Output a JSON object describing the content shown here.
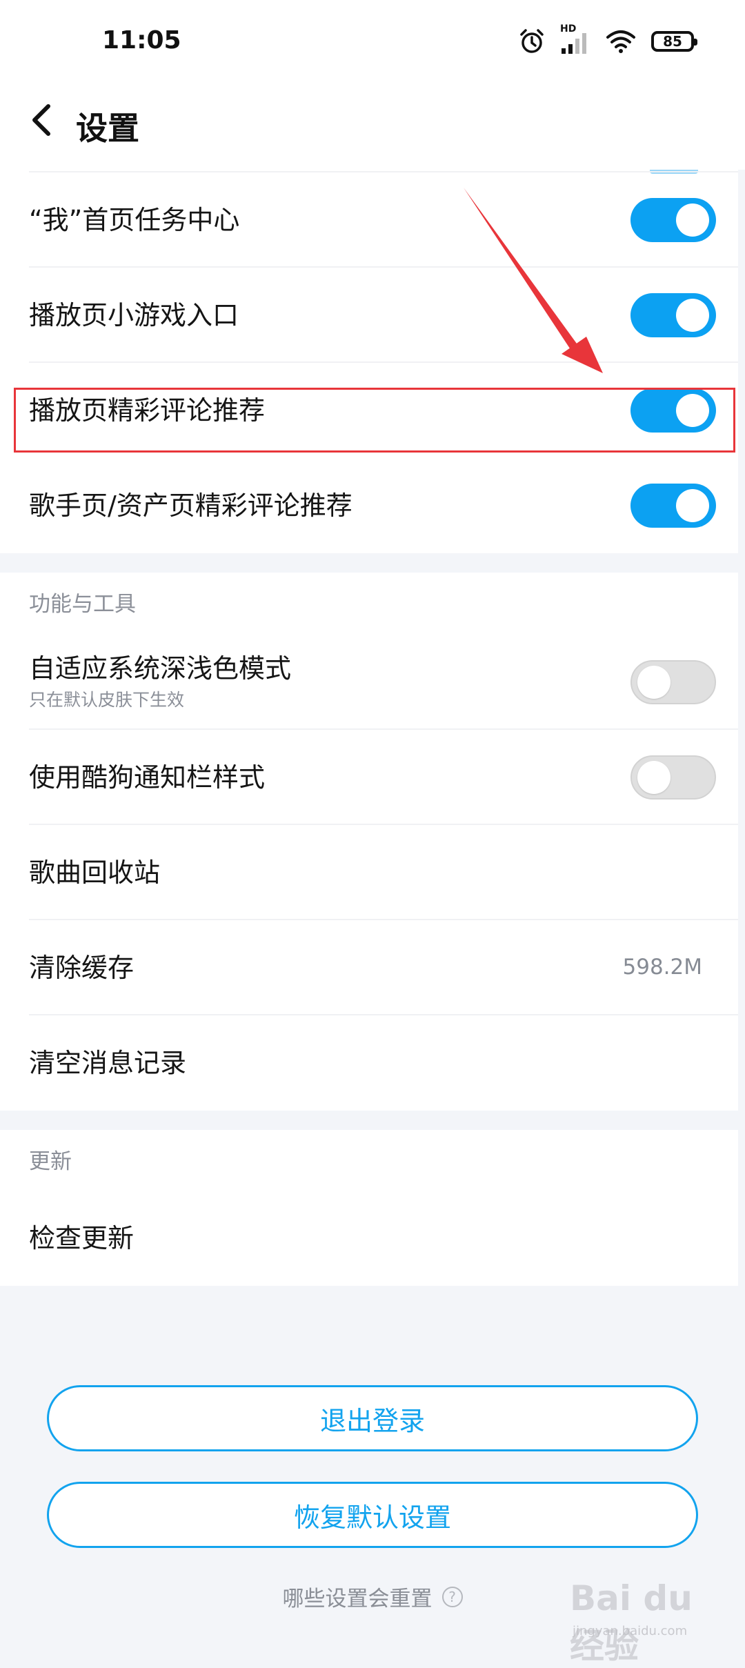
{
  "status_bar": {
    "time": "11:05",
    "hd_label": "HD",
    "battery": "85",
    "icons": [
      "alarm-icon",
      "cellular-signal-icon",
      "wifi-icon",
      "battery-icon"
    ]
  },
  "header": {
    "title": "设置",
    "back_icon": "chevron-left-icon"
  },
  "recommend_section": {
    "items": [
      {
        "label": "“我”首页任务中心",
        "toggle_on": true
      },
      {
        "label": "播放页小游戏入口",
        "toggle_on": true
      },
      {
        "label": "播放页精彩评论推荐",
        "toggle_on": true
      },
      {
        "label": "歌手页/资产页精彩评论推荐",
        "toggle_on": true
      }
    ]
  },
  "tools_section": {
    "title": "功能与工具",
    "dark_mode": {
      "label": "自适应系统深浅色模式",
      "sub": "只在默认皮肤下生效",
      "toggle_on": false
    },
    "notification_style": {
      "label": "使用酷狗通知栏样式",
      "toggle_on": false
    },
    "recycle_bin": {
      "label": "歌曲回收站"
    },
    "clear_cache": {
      "label": "清除缓存",
      "value": "598.2M"
    },
    "clear_messages": {
      "label": "清空消息记录"
    }
  },
  "update_section": {
    "title": "更新",
    "check_update": {
      "label": "检查更新"
    }
  },
  "actions": {
    "logout": "退出登录",
    "restore_defaults": "恢复默认设置",
    "reset_hint": "哪些设置会重置",
    "help_icon": "?"
  },
  "watermark": {
    "main": "Bai du 经验",
    "sub": "jingyan.baidu.com"
  },
  "colors": {
    "accent": "#0ca1f2",
    "annotation": "#e8353a"
  }
}
